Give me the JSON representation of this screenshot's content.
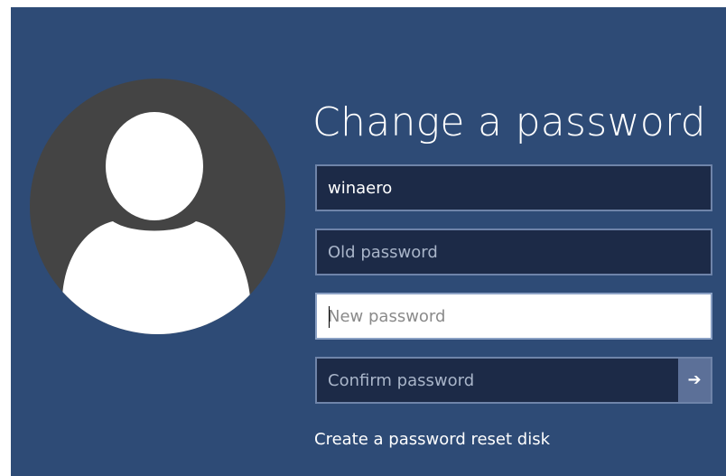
{
  "title": "Change a password",
  "fields": {
    "username": {
      "value": "winaero"
    },
    "old_password": {
      "value": "",
      "placeholder": "Old password"
    },
    "new_password": {
      "value": "",
      "placeholder": "New password"
    },
    "confirm_password": {
      "value": "",
      "placeholder": "Confirm password"
    }
  },
  "submit_icon": {
    "icon": "arrow-right-icon",
    "glyph": "➔"
  },
  "avatar_icon": "user-avatar-icon",
  "reset_link": "Create a password reset disk",
  "colors": {
    "background": "#2e4b76",
    "field_background": "#1c2a47",
    "field_border": "#6f84a9",
    "active_field_background": "#ffffff",
    "submit_button": "#5c7098",
    "avatar_circle": "#444444"
  }
}
